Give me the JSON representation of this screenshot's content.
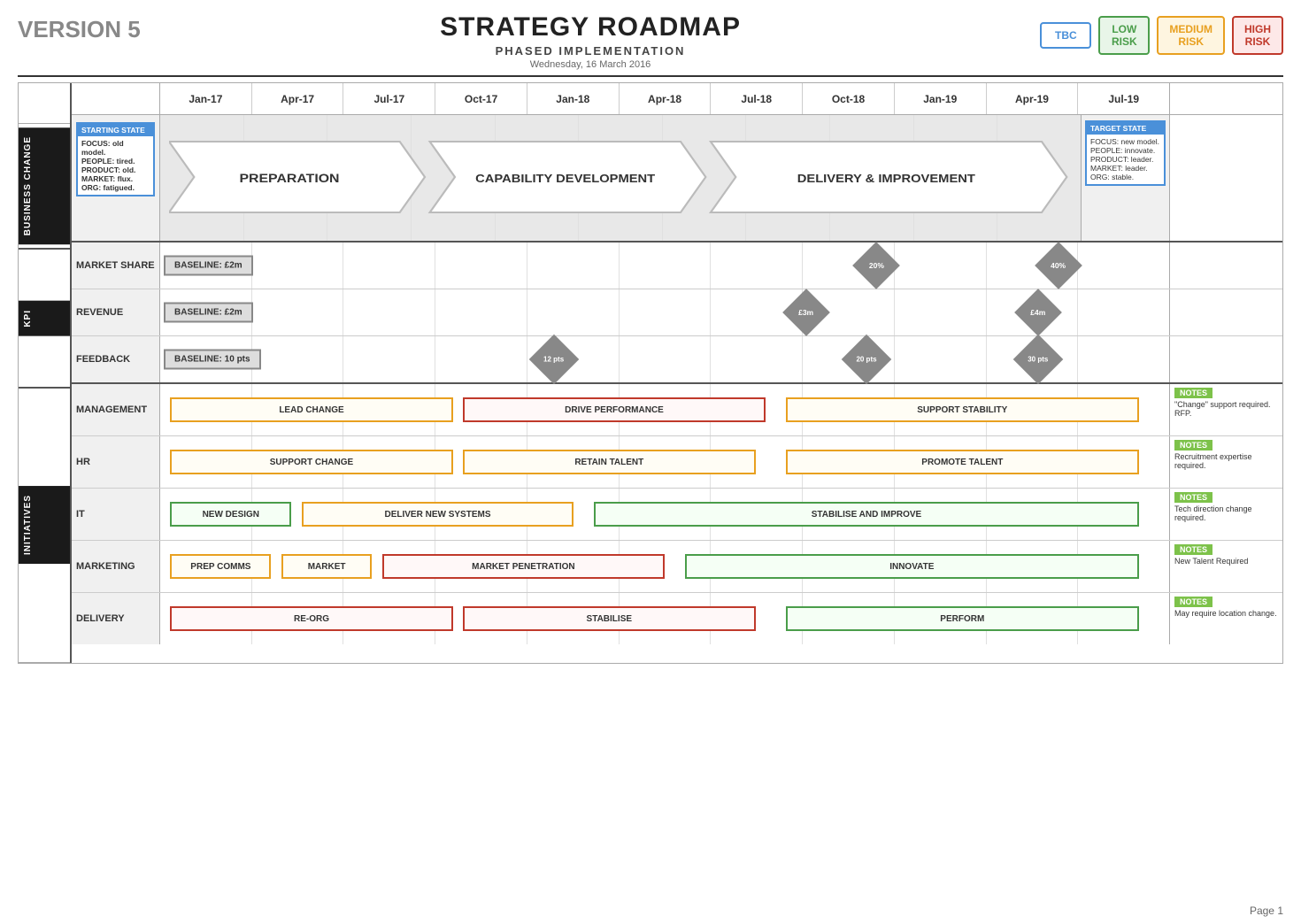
{
  "header": {
    "version": "VERSION 5",
    "title": "STRATEGY ROADMAP",
    "subtitle": "PHASED IMPLEMENTATION",
    "date": "Wednesday, 16 March 2016",
    "page": "Page 1"
  },
  "risk_badges": [
    {
      "label": "TBC",
      "class": "risk-tbc"
    },
    {
      "label": "LOW\nRISK",
      "class": "risk-low"
    },
    {
      "label": "MEDIUM\nRISK",
      "class": "risk-medium"
    },
    {
      "label": "HIGH\nRISK",
      "class": "risk-high"
    }
  ],
  "timeline": {
    "dates": [
      "Jan-17",
      "Apr-17",
      "Jul-17",
      "Oct-17",
      "Jan-18",
      "Apr-18",
      "Jul-18",
      "Oct-18",
      "Jan-19",
      "Apr-19",
      "Jul-19"
    ]
  },
  "business_change": {
    "label": "BUSINESS CHANGE",
    "starting_state": {
      "title": "STARTING STATE",
      "lines": [
        "FOCUS: old model.",
        "PEOPLE: tired.",
        "PRODUCT: old.",
        "MARKET: flux.",
        "ORG: fatigued."
      ]
    },
    "phases": [
      {
        "label": "PREPARATION",
        "start_pct": 8,
        "width_pct": 27
      },
      {
        "label": "CAPABILITY DEVELOPMENT",
        "start_pct": 36,
        "width_pct": 28
      },
      {
        "label": "DELIVERY & IMPROVEMENT",
        "start_pct": 65,
        "width_pct": 30
      }
    ],
    "target_state": {
      "title": "TARGET STATE",
      "lines": [
        "FOCUS: new model.",
        "PEOPLE: innovate.",
        "PRODUCT: leader.",
        "MARKET: leader.",
        "ORG: stable."
      ]
    }
  },
  "kpi": {
    "label": "KPI",
    "rows": [
      {
        "label": "MARKET SHARE",
        "baseline": "BASELINE: £2m",
        "milestones": [
          {
            "label": "20%",
            "pos_pct": 72
          },
          {
            "label": "40%",
            "pos_pct": 90
          }
        ]
      },
      {
        "label": "REVENUE",
        "baseline": "BASELINE: £2m",
        "milestones": [
          {
            "label": "£3m",
            "pos_pct": 65
          },
          {
            "label": "£4m",
            "pos_pct": 88
          }
        ]
      },
      {
        "label": "FEEDBACK",
        "baseline": "BASELINE: 10 pts",
        "milestones": [
          {
            "label": "12 pts",
            "pos_pct": 40
          },
          {
            "label": "20 pts",
            "pos_pct": 71
          },
          {
            "label": "30 pts",
            "pos_pct": 88
          }
        ]
      }
    ]
  },
  "initiatives": {
    "label": "INITIATIVES",
    "rows": [
      {
        "label": "MANAGEMENT",
        "bars": [
          {
            "text": "LEAD CHANGE",
            "start_pct": 1,
            "width_pct": 28,
            "style": "g-orange"
          },
          {
            "text": "DRIVE PERFORMANCE",
            "start_pct": 31,
            "width_pct": 30,
            "style": "g-red"
          },
          {
            "text": "SUPPORT STABILITY",
            "start_pct": 63,
            "width_pct": 33,
            "style": "g-orange"
          }
        ],
        "notes_label": "NOTES",
        "notes_text": "\"Change\" support required. RFP."
      },
      {
        "label": "HR",
        "bars": [
          {
            "text": "SUPPORT CHANGE",
            "start_pct": 1,
            "width_pct": 28,
            "style": "g-orange"
          },
          {
            "text": "RETAIN TALENT",
            "start_pct": 31,
            "width_pct": 29,
            "style": "g-orange"
          },
          {
            "text": "PROMOTE TALENT",
            "start_pct": 63,
            "width_pct": 33,
            "style": "g-orange"
          }
        ],
        "notes_label": "NOTES",
        "notes_text": "Recruitment expertise required."
      },
      {
        "label": "IT",
        "bars": [
          {
            "text": "NEW DESIGN",
            "start_pct": 1,
            "width_pct": 12,
            "style": "g-green"
          },
          {
            "text": "DELIVER NEW SYSTEMS",
            "start_pct": 14,
            "width_pct": 27,
            "style": "g-orange"
          },
          {
            "text": "STABILISE AND IMPROVE",
            "start_pct": 43,
            "width_pct": 53,
            "style": "g-green"
          }
        ],
        "notes_label": "NOTES",
        "notes_text": "Tech direction change required."
      },
      {
        "label": "MARKETING",
        "bars": [
          {
            "text": "PREP COMMS",
            "start_pct": 1,
            "width_pct": 10,
            "style": "g-orange"
          },
          {
            "text": "MARKET",
            "start_pct": 12,
            "width_pct": 10,
            "style": "g-orange"
          },
          {
            "text": "MARKET PENETRATION",
            "start_pct": 23,
            "width_pct": 28,
            "style": "g-red"
          },
          {
            "text": "INNOVATE",
            "start_pct": 53,
            "width_pct": 43,
            "style": "g-green"
          }
        ],
        "notes_label": "NOTES",
        "notes_text": "New Talent Required"
      },
      {
        "label": "DELIVERY",
        "bars": [
          {
            "text": "RE-ORG",
            "start_pct": 1,
            "width_pct": 28,
            "style": "g-red"
          },
          {
            "text": "STABILISE",
            "start_pct": 31,
            "width_pct": 29,
            "style": "g-red"
          },
          {
            "text": "PERFORM",
            "start_pct": 63,
            "width_pct": 33,
            "style": "g-green"
          }
        ],
        "notes_label": "NOTES",
        "notes_text": "May require location change."
      }
    ]
  }
}
